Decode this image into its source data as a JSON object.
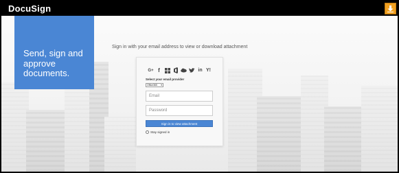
{
  "header": {
    "logo_text": "DocuSign",
    "download_icon": "download-arrow-icon",
    "download_color": "#f0a020"
  },
  "promo": {
    "text": "Send, sign and approve documents.",
    "color": "#4a86d4"
  },
  "instruction": "Sign in with your email address to view or download attachment",
  "providers": {
    "icons": [
      "google-plus-icon",
      "facebook-icon",
      "windows-icon",
      "office-icon",
      "cloud-icon",
      "twitter-icon",
      "linkedin-icon",
      "yahoo-icon"
    ],
    "label": "Select your email provider",
    "selected": "Office365"
  },
  "form": {
    "email_placeholder": "Email",
    "password_placeholder": "Password",
    "submit_label": "Sign in to view attachment",
    "stay_label": "Stay signed in"
  }
}
